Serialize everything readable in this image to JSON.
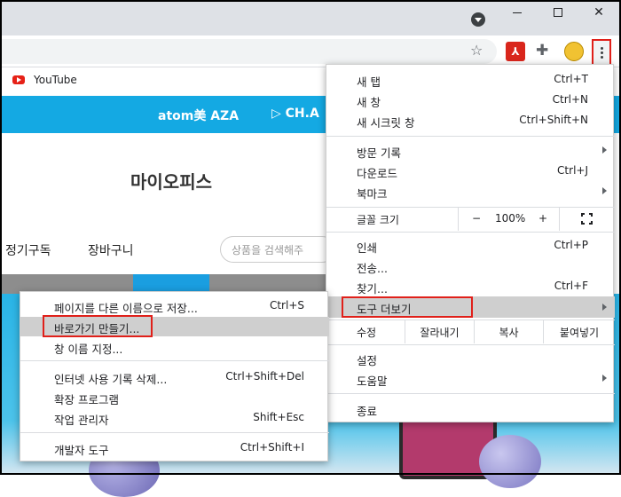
{
  "browser": {
    "bookmark_youtube": "YouTube",
    "menu_button": "⋮"
  },
  "page": {
    "banner_brand_1": "atom美 AZA",
    "banner_brand_2": "▷ CH.A",
    "title": "마이오피스",
    "nav_subscription": "정기구독",
    "nav_cart": "장바구니",
    "search_placeholder": "상품을 검색해주"
  },
  "menu": {
    "new_tab": {
      "label": "새 탭",
      "shortcut": "Ctrl+T"
    },
    "new_window": {
      "label": "새 창",
      "shortcut": "Ctrl+N"
    },
    "incognito": {
      "label": "새 시크릿 창",
      "shortcut": "Ctrl+Shift+N"
    },
    "history": {
      "label": "방문 기록"
    },
    "downloads": {
      "label": "다운로드",
      "shortcut": "Ctrl+J"
    },
    "bookmarks": {
      "label": "북마크"
    },
    "zoom": {
      "label": "글꼴 크기",
      "minus": "−",
      "value": "100%",
      "plus": "+"
    },
    "print": {
      "label": "인쇄",
      "shortcut": "Ctrl+P"
    },
    "cast": {
      "label": "전송..."
    },
    "find": {
      "label": "찾기...",
      "shortcut": "Ctrl+F"
    },
    "more_tools": {
      "label": "도구 더보기"
    },
    "edit": {
      "label": "수정",
      "cut": "잘라내기",
      "copy": "복사",
      "paste": "붙여넣기"
    },
    "settings": {
      "label": "설정"
    },
    "help": {
      "label": "도움말"
    },
    "exit": {
      "label": "종료"
    }
  },
  "submenu": {
    "save_page": {
      "label": "페이지를 다른 이름으로 저장...",
      "shortcut": "Ctrl+S"
    },
    "create_shortcut": {
      "label": "바로가기 만들기..."
    },
    "name_window": {
      "label": "창 이름 지정..."
    },
    "clear_data": {
      "label": "인터넷 사용 기록 삭제...",
      "shortcut": "Ctrl+Shift+Del"
    },
    "extensions": {
      "label": "확장 프로그램"
    },
    "task_manager": {
      "label": "작업 관리자",
      "shortcut": "Shift+Esc"
    },
    "dev_tools": {
      "label": "개발자 도구",
      "shortcut": "Ctrl+Shift+I"
    }
  }
}
